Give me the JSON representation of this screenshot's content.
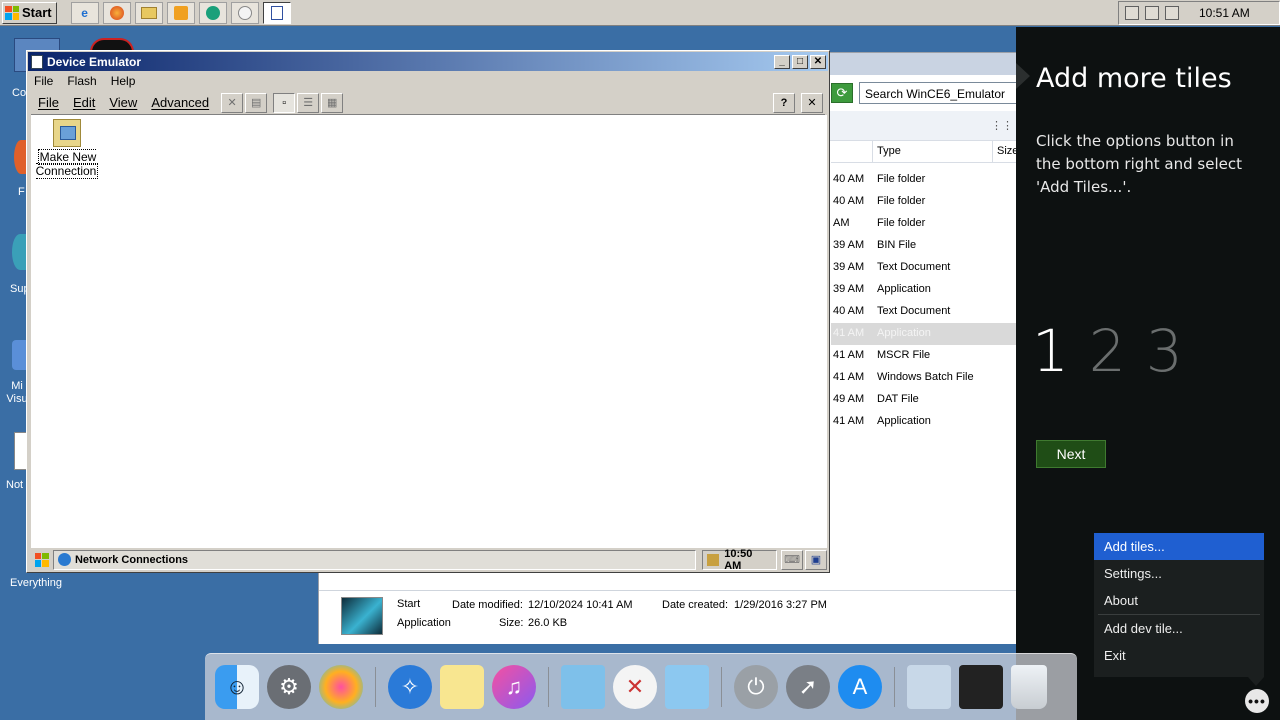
{
  "topbar": {
    "start_label": "Start",
    "time": "10:51 AM",
    "quicklaunch": [
      "ie-icon",
      "firefox-icon",
      "explorer-icon",
      "media-icon",
      "globe-icon",
      "app-icon",
      "document-icon"
    ]
  },
  "desktop": {
    "icons": [
      "Co",
      "F",
      "Sup",
      "Mi Visu",
      "Not",
      "Everything"
    ]
  },
  "explorer": {
    "search_placeholder": "Search WinCE6_Emulator",
    "columns": [
      "Type",
      "Size"
    ],
    "rows": [
      {
        "time": "40 AM",
        "type": "File folder"
      },
      {
        "time": "40 AM",
        "type": "File folder"
      },
      {
        "time": "AM",
        "type": "File folder"
      },
      {
        "time": "39 AM",
        "type": "BIN File"
      },
      {
        "time": "39 AM",
        "type": "Text Document"
      },
      {
        "time": "39 AM",
        "type": "Application"
      },
      {
        "time": "40 AM",
        "type": "Text Document"
      },
      {
        "time": "41 AM",
        "type": "Application"
      },
      {
        "time": "41 AM",
        "type": "MSCR File"
      },
      {
        "time": "41 AM",
        "type": "Windows Batch File"
      },
      {
        "time": "49 AM",
        "type": "DAT File"
      },
      {
        "time": "41 AM",
        "type": "Application"
      }
    ],
    "selected_row": 7,
    "details": {
      "name": "Start",
      "kind": "Application",
      "modified_label": "Date modified:",
      "modified": "12/10/2024 10:41 AM",
      "created_label": "Date created:",
      "created": "1/29/2016 3:27 PM",
      "size_label": "Size:",
      "size": "26.0 KB"
    }
  },
  "emulator": {
    "title": "Device Emulator",
    "menu": [
      "File",
      "Flash",
      "Help"
    ],
    "ce_menu": [
      "File",
      "Edit",
      "View",
      "Advanced"
    ],
    "help_btn": "?",
    "close_btn": "✕",
    "item_label": "Make New Connection",
    "task_label": "Network Connections",
    "ce_time": "10:50 AM"
  },
  "tiles": {
    "title": "Add more tiles",
    "body": "Click the options button in the bottom right and select 'Add Tiles...'.",
    "steps": [
      "1",
      "2",
      "3"
    ],
    "current_step": 1,
    "next_label": "Next",
    "context_menu": [
      "Add tiles...",
      "Settings...",
      "About",
      "Add dev tile...",
      "Exit"
    ],
    "options_label": "•••"
  },
  "dock": {
    "apps": [
      "finder-icon",
      "system-preferences-icon",
      "photos-icon",
      "safari-icon",
      "notes-icon",
      "itunes-icon",
      "folder-icon",
      "x-icon",
      "applications-folder-icon",
      "power-icon",
      "launchpad-icon",
      "app-store-icon",
      "preview-icon",
      "photo-booth-icon",
      "trash-icon"
    ]
  },
  "colors": {
    "accent_blue": "#1f5fd1",
    "next_green": "#1f4d16",
    "tiles_bg": "#0d1111"
  }
}
